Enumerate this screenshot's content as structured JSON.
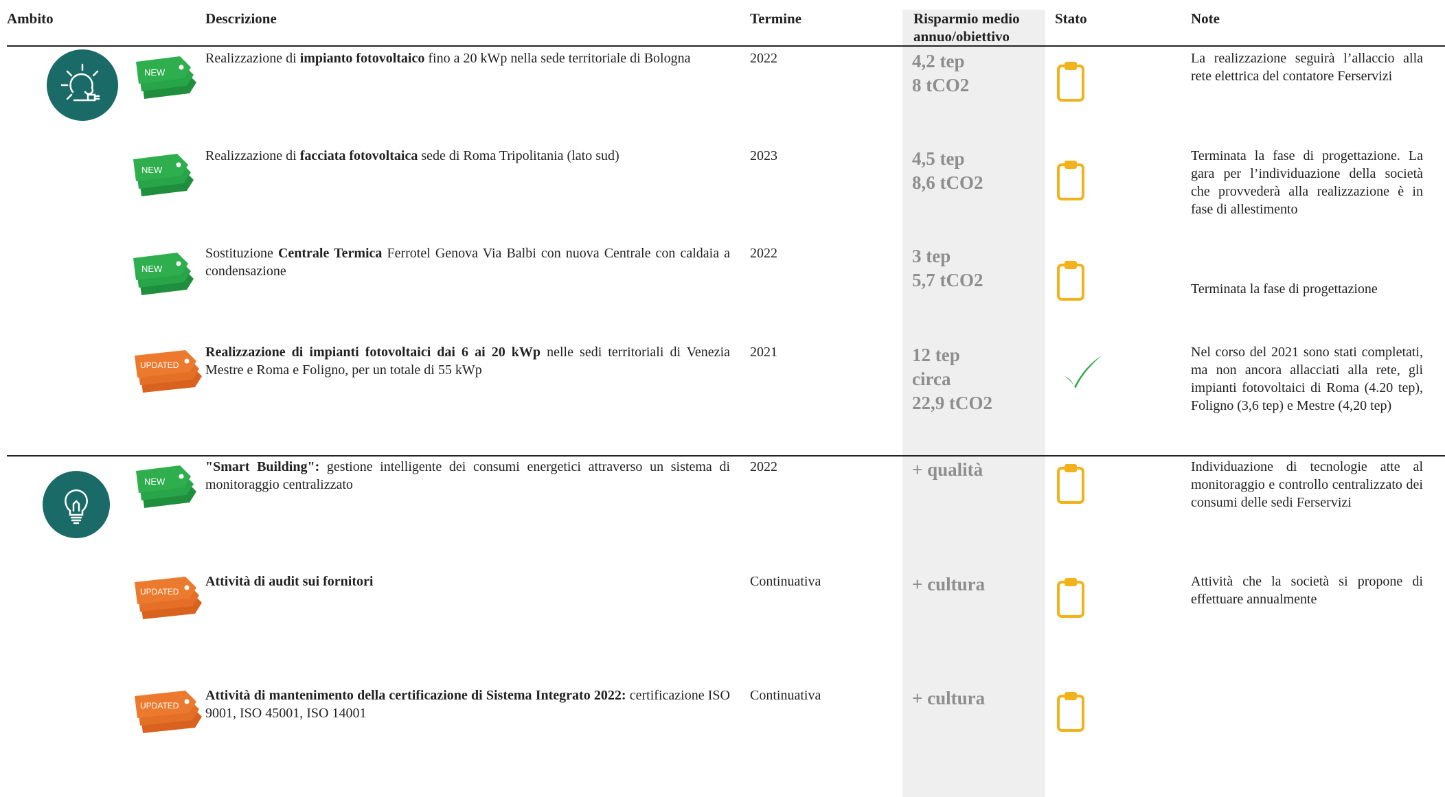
{
  "headers": {
    "ambito": "Ambito",
    "descrizione": "Descrizione",
    "termine": "Termine",
    "risparmio": "Risparmio medio annuo/obiettivo",
    "stato": "Stato",
    "note": "Note"
  },
  "icons": {
    "solar": "solar-energy-icon",
    "bulb": "lightbulb-icon",
    "status_pending": "clipboard-icon",
    "status_done": "checkmark-icon"
  },
  "colors": {
    "teal": "#1a6b67",
    "new_tag": "#2fae4e",
    "updated_tag": "#ec7a2e",
    "clipboard": "#f2b21b",
    "check": "#2aa645",
    "savings_bg": "#efefef",
    "savings_text": "#8e8e8e"
  },
  "rows": [
    {
      "tag": "NEW",
      "desc_pre": "Realizzazione di ",
      "desc_bold": "impianto fotovoltaico",
      "desc_post": " fino a 20 kWp nella sede territoriale di Bologna",
      "termine": "2022",
      "saving1": "4,2 tep",
      "saving2": "8 tCO2",
      "saving3": "",
      "stato": "clipboard",
      "note": "La realizzazione seguirà l’allaccio alla rete elettrica del contatore Ferservizi"
    },
    {
      "tag": "NEW",
      "desc_pre": "Realizzazione di ",
      "desc_bold": "facciata fotovoltaica",
      "desc_post": " sede di Roma Tripolitania (lato sud)",
      "termine": "2023",
      "saving1": "4,5 tep",
      "saving2": "8,6 tCO2",
      "saving3": "",
      "stato": "clipboard",
      "note": "Terminata la fase di progettazione. La gara per l’individuazione della società che provvederà alla realizzazione è in fase di allestimento"
    },
    {
      "tag": "NEW",
      "desc_pre": "Sostituzione ",
      "desc_bold": "Centrale Termica",
      "desc_post": " Ferrotel Genova Via Balbi con nuova Centrale con caldaia a condensazione",
      "termine": "2022",
      "saving1": "3 tep",
      "saving2": "5,7 tCO2",
      "saving3": "",
      "stato": "clipboard",
      "note": "Terminata la fase di progettazione"
    },
    {
      "tag": "UPDATED",
      "desc_pre": "",
      "desc_bold": "Realizzazione di impianti fotovoltaici dai 6 ai 20 kWp",
      "desc_post": " nelle sedi territoriali di Venezia Mestre e Roma e Foligno, per un totale di 55 kWp",
      "termine": "2021",
      "saving1": "12 tep",
      "saving2": "circa",
      "saving3": "22,9 tCO2",
      "stato": "check",
      "note": "Nel corso del 2021 sono stati completati, ma non ancora allacciati alla rete, gli impianti fotovoltaici di Roma (4.20 tep), Foligno (3,6 tep) e Mestre (4,20 tep)"
    },
    {
      "tag": "NEW",
      "desc_pre": "",
      "desc_bold": "\"Smart Building\":",
      "desc_post": " gestione intelligente dei consumi energetici attraverso un sistema di monitoraggio centralizzato",
      "termine": "2022",
      "saving1": "+ qualità",
      "saving2": "",
      "saving3": "",
      "stato": "clipboard",
      "note": "Individuazione di tecnologie atte al monitoraggio e controllo centralizzato dei consumi delle sedi Ferservizi"
    },
    {
      "tag": "UPDATED",
      "desc_pre": "",
      "desc_bold": "Attività di audit sui fornitori",
      "desc_post": "",
      "termine": "Continuativa",
      "saving1": "+ cultura",
      "saving2": "",
      "saving3": "",
      "stato": "clipboard",
      "note": "Attività che la società si propone di effettuare annualmente"
    },
    {
      "tag": "UPDATED",
      "desc_pre": "",
      "desc_bold": "Attività di mantenimento della certificazione di Sistema Integrato 2022:",
      "desc_post": " certificazione ISO 9001, ISO 45001, ISO 14001",
      "termine": "Continuativa",
      "saving1": "+ cultura",
      "saving2": "",
      "saving3": "",
      "stato": "clipboard",
      "note": ""
    }
  ]
}
